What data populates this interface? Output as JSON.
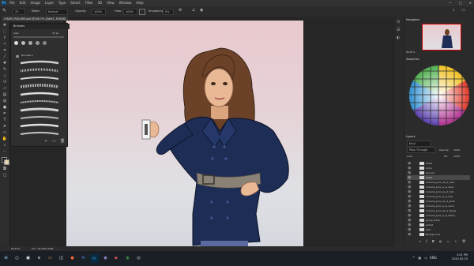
{
  "menubar": {
    "logo": "Ps",
    "items": [
      "File",
      "Edit",
      "Image",
      "Layer",
      "Type",
      "Select",
      "Filter",
      "3D",
      "View",
      "Window",
      "Help"
    ],
    "controls": {
      "minimize": "—",
      "maximize": "□",
      "close": "✕"
    }
  },
  "options": {
    "size": "25",
    "mode_label": "Mode:",
    "mode": "Normal",
    "opacity_label": "Opacity:",
    "opacity": "100%",
    "flow_label": "Flow:",
    "flow": "100%",
    "smoothing_label": "Smoothing:",
    "smoothing": "0%"
  },
  "document": {
    "tab_title": "CHAR1 RELORE.psd @ 66.7% (Safe1, RGB/8)"
  },
  "brushes_panel": {
    "title": "Brushes",
    "size_label": "Size:",
    "size_value": "25 px",
    "folder_label": "Brushes 1"
  },
  "navigator": {
    "title": "Navigator",
    "zoom": "66.67%"
  },
  "swatches": {
    "title": "Swatches",
    "colors": [
      "#f2f2f2",
      "#d9d9d9",
      "#b0b0b0",
      "#8a8a8a",
      "#5e5e5e",
      "#2c2c2c",
      "#e8c9a0",
      "#d9a46e",
      "#b36b3c",
      "#7a3f20",
      "#f7d9c4",
      "#e8b7a3",
      "#c9826b",
      "#94503f",
      "#f0e6a0",
      "#c8d86a",
      "#7fb84a",
      "#3d8a3a",
      "#a8d8e8",
      "#5fa8d0",
      "#2f6aa8",
      "#1f3a78",
      "#c8a8e0",
      "#8a5ab8",
      "#5a2f88",
      "#e890b0",
      "#c84878",
      "#8a2048",
      "#f0f0d8",
      "#d8c090"
    ]
  },
  "layers": {
    "title": "Layers",
    "kind": "Kind",
    "blend": "Pass Through",
    "opacity_label": "Opacity:",
    "opacity": "100%",
    "fill_label": "Fill:",
    "fill": "100%",
    "lock_label": "Lock:",
    "rows": [
      {
        "label": "Safe1"
      },
      {
        "label": "arms"
      },
      {
        "label": "Ground"
      },
      {
        "label": "Safe1"
      },
      {
        "label": "romana_pom_aa_d_hear"
      },
      {
        "label": "romana_pom_a_w_hear"
      },
      {
        "label": "romana_pom_aa_d_frat"
      },
      {
        "label": "romana_pom_a_w_frat"
      },
      {
        "label": "romana_pom_aa_d_work"
      },
      {
        "label": "romana_pom_a_w_work"
      },
      {
        "label": "romana_pom_aa_d_fadya"
      },
      {
        "label": "romana_pom_a_w_fadya"
      },
      {
        "label": "group_frank"
      },
      {
        "label": "jacket"
      },
      {
        "label": "skirt"
      },
      {
        "label": "Background"
      }
    ]
  },
  "statusbar": {
    "zoom": "66.67%",
    "doc": "Doc: 60.2M/4.99M"
  },
  "taskbar": {
    "time": "3:01 PM",
    "date": "2020-03-25",
    "lang": "ENG"
  },
  "colors": {
    "accent": "#31a8ff",
    "coat": "#1e2d55",
    "hair": "#6b4128",
    "skin": "#e9b894",
    "belt": "#8a8277"
  }
}
